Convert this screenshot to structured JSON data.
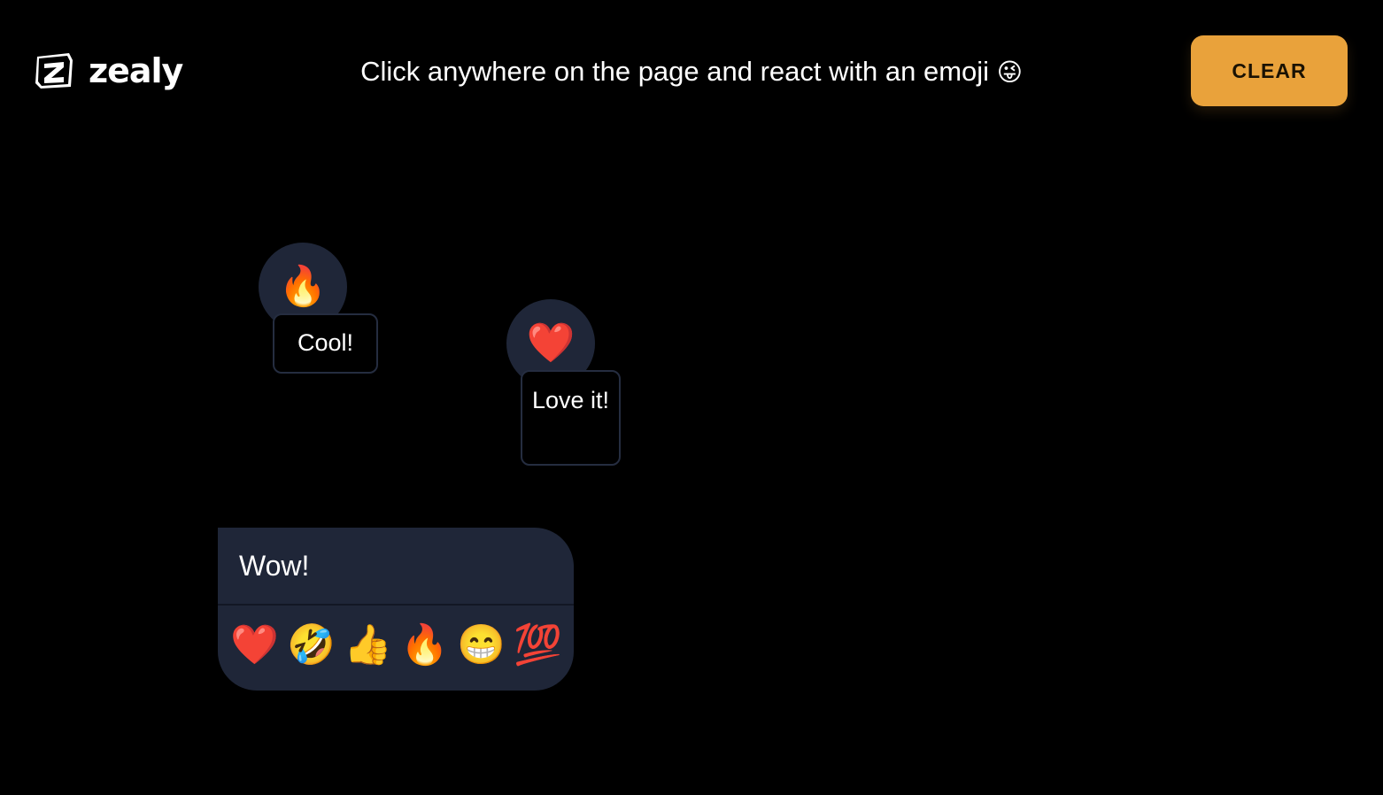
{
  "header": {
    "brand": "zealy",
    "instruction": "Click anywhere on the page and react with an emoji",
    "instruction_emoji": "😜",
    "clear_label": "CLEAR"
  },
  "reactions": [
    {
      "emoji": "🔥",
      "label": "Cool!"
    },
    {
      "emoji": "❤️",
      "label": "Love it!"
    }
  ],
  "composer": {
    "value": "Wow!",
    "emojis": [
      "❤️",
      "🤣",
      "👍",
      "🔥",
      "😁",
      "💯"
    ]
  },
  "colors": {
    "background": "#000000",
    "accent": "#e9a23b",
    "panel": "#1f2638"
  }
}
